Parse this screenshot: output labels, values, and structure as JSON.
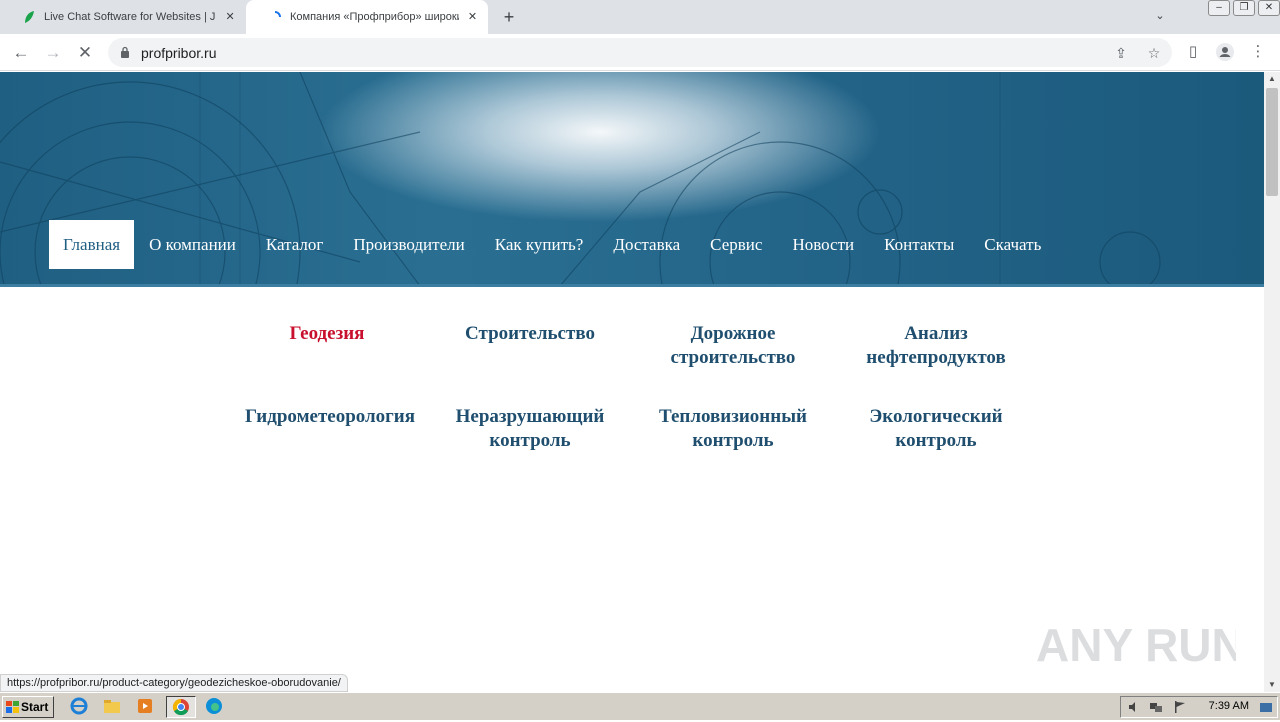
{
  "browser": {
    "tabs": [
      {
        "title": "Live Chat Software for Websites | Ji",
        "active": false
      },
      {
        "title": "Компания «Профприбор» широкий",
        "active": true
      }
    ],
    "url": "profpribor.ru",
    "status_url": "https://profpribor.ru/product-category/geodezicheskoe-oborudovanie/"
  },
  "site": {
    "nav": [
      {
        "label": "Главная",
        "active": true
      },
      {
        "label": "О компании"
      },
      {
        "label": "Каталог"
      },
      {
        "label": "Производители"
      },
      {
        "label": "Как купить?"
      },
      {
        "label": "Доставка"
      },
      {
        "label": "Сервис"
      },
      {
        "label": "Новости"
      },
      {
        "label": "Контакты"
      },
      {
        "label": "Скачать"
      }
    ],
    "categories": [
      {
        "line1": "Геодезия",
        "line2": "",
        "highlight": true
      },
      {
        "line1": "Строительство",
        "line2": ""
      },
      {
        "line1": "Дорожное",
        "line2": "строительство"
      },
      {
        "line1": "Анализ",
        "line2": "нефтепродуктов"
      },
      {
        "line1": "Гидрометеорология",
        "line2": ""
      },
      {
        "line1": "Неразрушающий",
        "line2": "контроль"
      },
      {
        "line1": "Тепловизионный",
        "line2": "контроль"
      },
      {
        "line1": "Экологический",
        "line2": "контроль"
      }
    ],
    "colors": {
      "header_blue": "#1f5f82",
      "category_text": "#1f4e6e",
      "highlight_red": "#c8102e"
    }
  },
  "watermark": "ANY RUN",
  "taskbar": {
    "start_label": "Start",
    "clock": "7:39 AM"
  }
}
